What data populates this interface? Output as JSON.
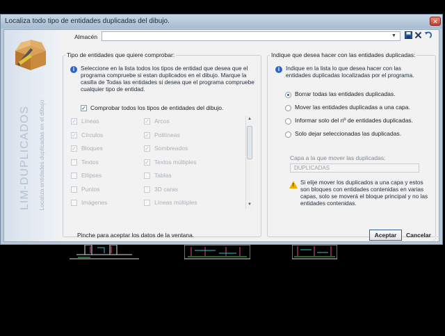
{
  "window": {
    "title": "Localiza todo tipo de entidades duplicadas del dibujo.",
    "close_symbol": "✕"
  },
  "brand": {
    "product": "LIM-DUPLICADOS",
    "tagline": "Localiza entidades duplicadas en el dibujo"
  },
  "almacen": {
    "label": "Almacén",
    "value": ""
  },
  "left_group": {
    "title": "Tipo de entidades que quiere comprobar:",
    "description": "Seleccione en la lista todos los tipos de entidad que desea que el programa compruebe si estan duplicados en el dibujo. Marque la casilla de Todas las entidades si desea que el programa compruebe cualquier tipo de entidad.",
    "check_all_label": "Comprobar todos los tipos de entidades del dibujo.",
    "col1": [
      {
        "label": "Líneas",
        "checked": true
      },
      {
        "label": "Círculos",
        "checked": true
      },
      {
        "label": "Bloques",
        "checked": true
      },
      {
        "label": "Textos",
        "checked": false
      },
      {
        "label": "Ellipses",
        "checked": false
      },
      {
        "label": "Puntos",
        "checked": false
      },
      {
        "label": "Imágenes",
        "checked": false
      }
    ],
    "col2": [
      {
        "label": "Arcos",
        "checked": true
      },
      {
        "label": "Polilíneas",
        "checked": true
      },
      {
        "label": "Sombreados",
        "checked": true
      },
      {
        "label": "Textos múltiples",
        "checked": true
      },
      {
        "label": "Tablas",
        "checked": false
      },
      {
        "label": "3D caras",
        "checked": false
      },
      {
        "label": "Líneas múltiples",
        "checked": false
      }
    ]
  },
  "right_group": {
    "title": "Indique que desea hacer con las entidades duplicadas:",
    "description": "Indique en la lista lo que desea hacer con las entidades duplicadas localizadas por el programa.",
    "options": [
      {
        "label": "Borrar todas las entidades duplicadas.",
        "selected": true
      },
      {
        "label": "Mover las entidades duplicadas a una capa.",
        "selected": false
      },
      {
        "label": "Informar solo del nº de entidades duplicadas.",
        "selected": false
      },
      {
        "label": "Solo dejar seleccionadas las duplicadas.",
        "selected": false
      }
    ],
    "capa_label": "Capa a la que mover las duplicadas:",
    "capa_value": "DUPLICADAS",
    "warning": "Si elije mover los duplicados a una capa y estos son bloques con entidades contenidas en varias capas, solo se moverá el bloque principal y no las entidades contenidas."
  },
  "status": {
    "text": "Pinche para aceptar los datos de la ventana."
  },
  "buttons": {
    "accept": "Aceptar",
    "cancel": "Cancelar"
  },
  "icons": {
    "save": "save-icon",
    "close": "close-icon",
    "undo": "undo-icon",
    "info": "info-icon",
    "warning": "warning-icon"
  },
  "colors": {
    "titlebar": "#b0c3d6",
    "accent": "#2f66c4",
    "warning": "#e8b100"
  }
}
